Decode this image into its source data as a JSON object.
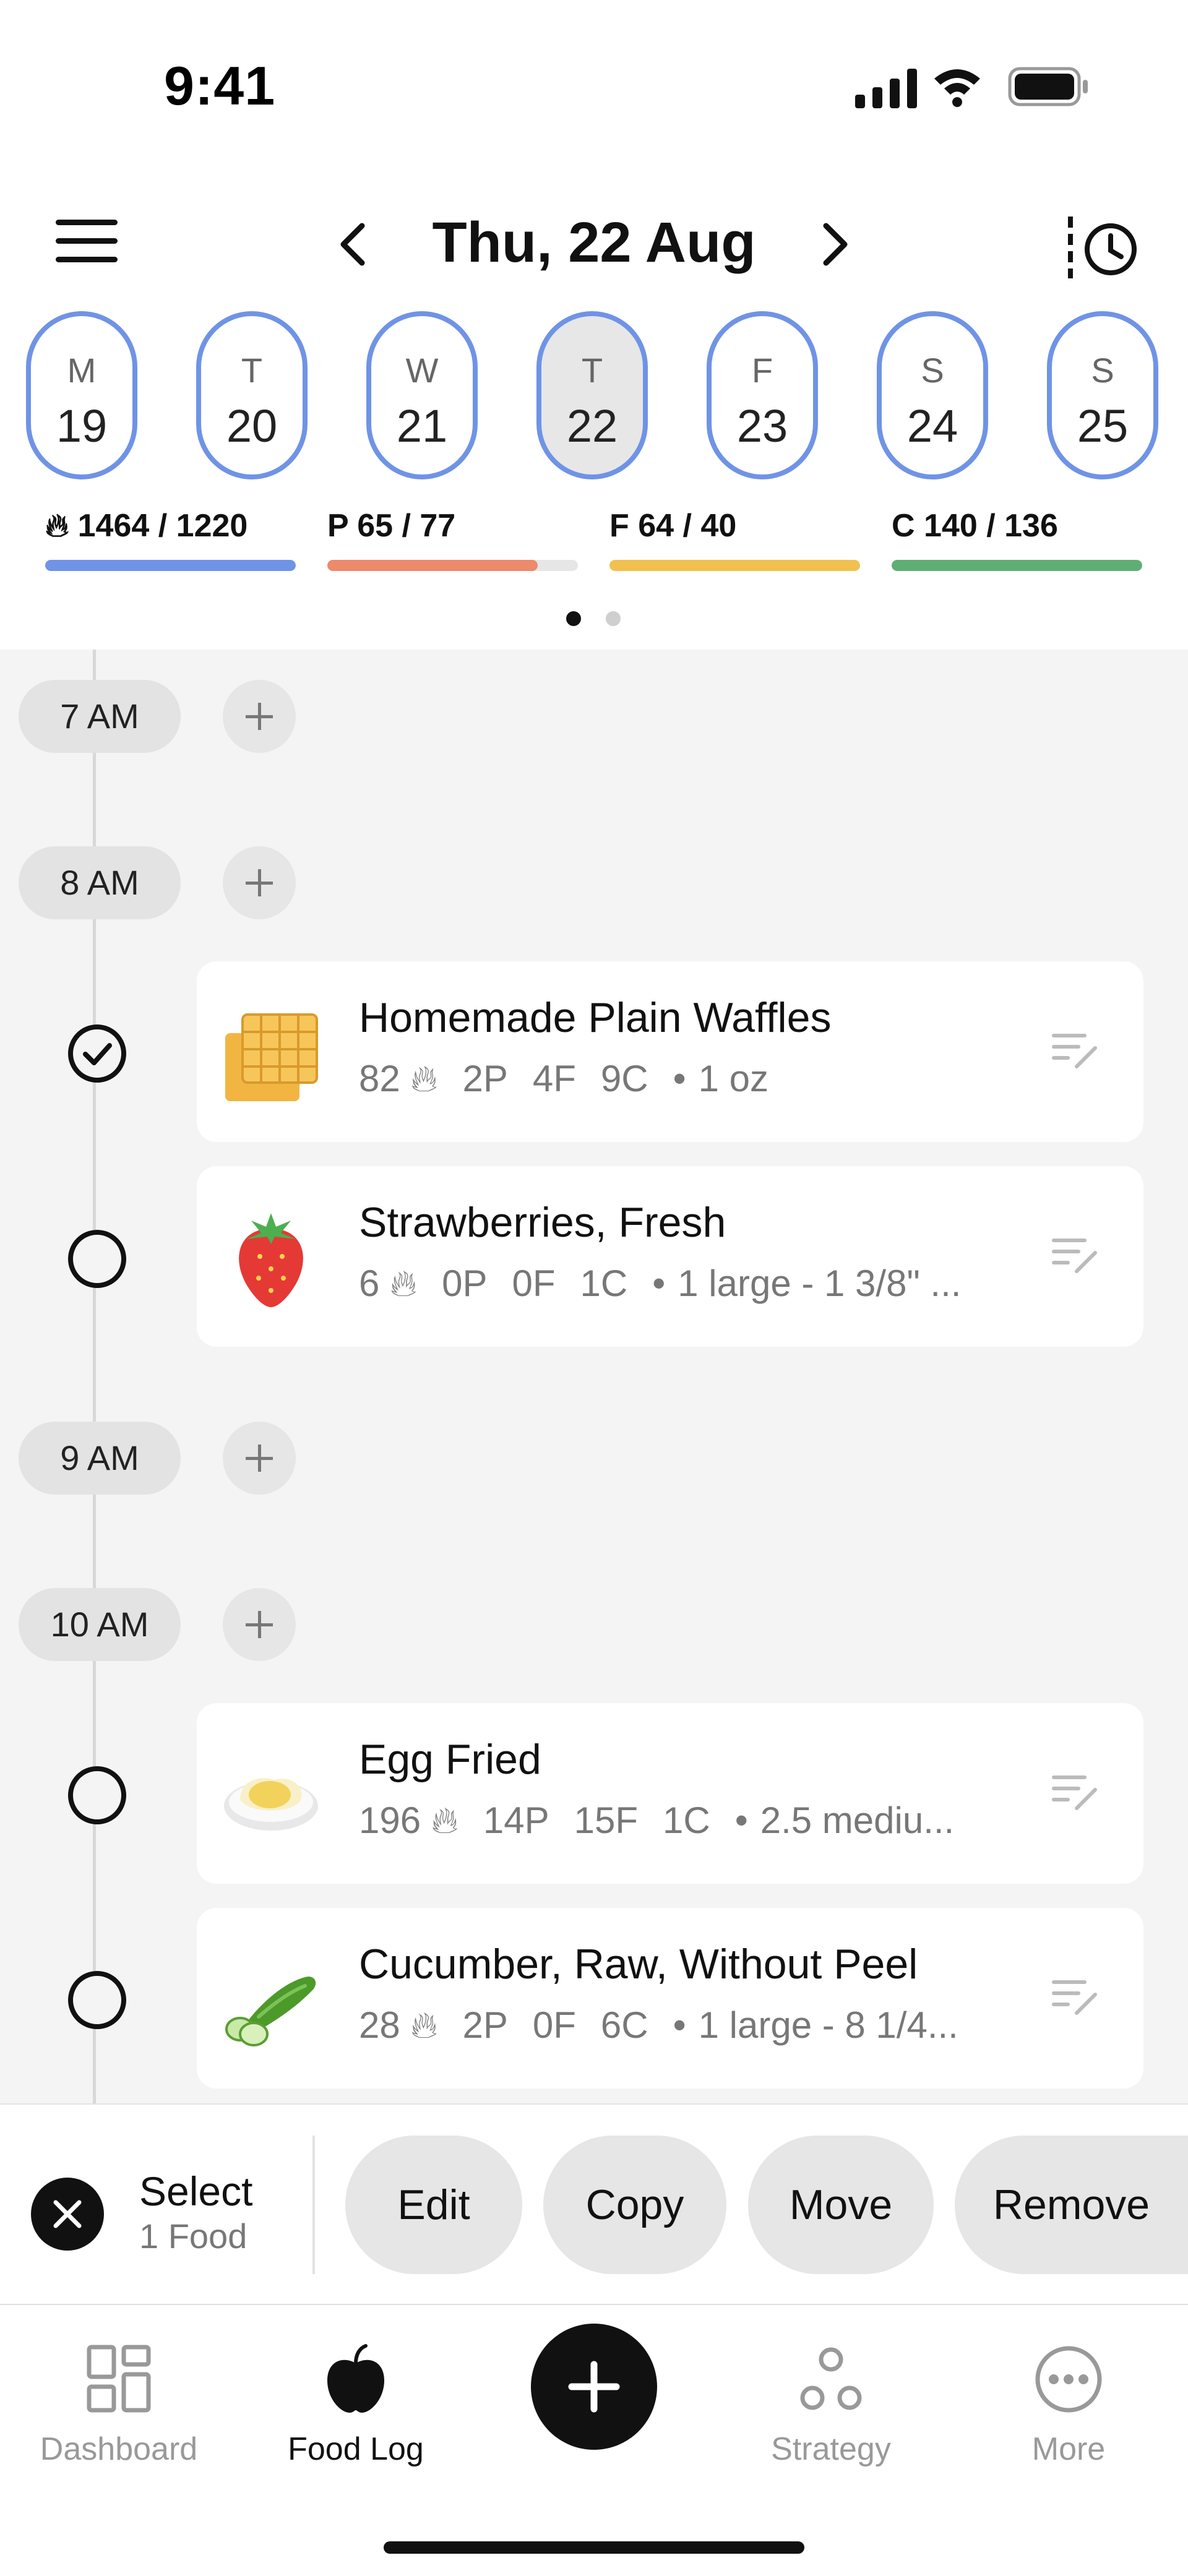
{
  "status_bar": {
    "time": "9:41"
  },
  "header": {
    "date_title": "Thu, 22 Aug"
  },
  "week": [
    {
      "letter": "M",
      "day": "19",
      "selected": false
    },
    {
      "letter": "T",
      "day": "20",
      "selected": false
    },
    {
      "letter": "W",
      "day": "21",
      "selected": false
    },
    {
      "letter": "T",
      "day": "22",
      "selected": true
    },
    {
      "letter": "F",
      "day": "23",
      "selected": false
    },
    {
      "letter": "S",
      "day": "24",
      "selected": false
    },
    {
      "letter": "S",
      "day": "25",
      "selected": false
    }
  ],
  "macros": {
    "calories": {
      "label": "1464 / 1220",
      "progress": 1.0,
      "color": "#6f93e6"
    },
    "protein": {
      "prefix": "P",
      "label": "65 / 77",
      "progress": 0.84,
      "color": "#ec8a69"
    },
    "fat": {
      "prefix": "F",
      "label": "64 / 40",
      "progress": 1.0,
      "color": "#f1c04f"
    },
    "carbs": {
      "prefix": "C",
      "label": "140 / 136",
      "progress": 1.0,
      "color": "#5fae74"
    }
  },
  "pager": {
    "pages": 2,
    "active": 0
  },
  "timeline": {
    "slots": [
      "7 AM",
      "8 AM",
      "9 AM",
      "10 AM"
    ],
    "foods": [
      {
        "name": "Homemade Plain Waffles",
        "cal": "82",
        "p": "2P",
        "f": "4F",
        "c": "9C",
        "serving": "1 oz",
        "checked": true,
        "icon": "waffle-icon"
      },
      {
        "name": "Strawberries, Fresh",
        "cal": "6",
        "p": "0P",
        "f": "0F",
        "c": "1C",
        "serving": "1 large - 1 3/8\" ...",
        "checked": false,
        "icon": "strawberry-icon"
      },
      {
        "name": "Egg Fried",
        "cal": "196",
        "p": "14P",
        "f": "15F",
        "c": "1C",
        "serving": "2.5 mediu...",
        "checked": false,
        "icon": "fried-egg-icon"
      },
      {
        "name": "Cucumber, Raw, Without Peel",
        "cal": "28",
        "p": "2P",
        "f": "0F",
        "c": "6C",
        "serving": "1 large - 8 1/4...",
        "checked": false,
        "icon": "cucumber-icon"
      }
    ]
  },
  "action_bar": {
    "title": "Select",
    "subtitle": "1 Food",
    "buttons": {
      "edit": "Edit",
      "copy": "Copy",
      "move": "Move",
      "remove": "Remove"
    }
  },
  "tabs": {
    "dashboard": "Dashboard",
    "food_log": "Food Log",
    "strategy": "Strategy",
    "more": "More"
  }
}
